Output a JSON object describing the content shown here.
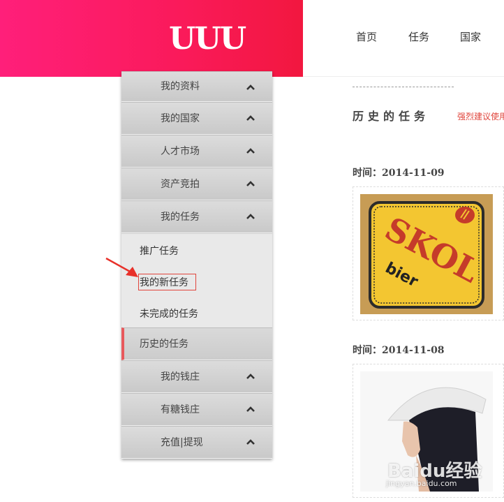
{
  "header": {
    "logo_text": "UUU",
    "nav": [
      {
        "label": "首页"
      },
      {
        "label": "任务"
      },
      {
        "label": "国家"
      }
    ]
  },
  "sidebar": {
    "items": [
      {
        "label": "我的资料"
      },
      {
        "label": "我的国家"
      },
      {
        "label": "人才市场"
      },
      {
        "label": "资产竞拍"
      },
      {
        "label": "我的任务"
      }
    ],
    "submenu": [
      {
        "label": "推广任务"
      },
      {
        "label": "我的新任务"
      },
      {
        "label": "未完成的任务"
      }
    ],
    "active_item": {
      "label": "历史的任务"
    },
    "bottom_items": [
      {
        "label": "我的钱庄"
      },
      {
        "label": "有糖钱庄"
      },
      {
        "label": "充值|提现"
      }
    ]
  },
  "content": {
    "title": "历史的任务",
    "note": "强烈建议使用",
    "entries": [
      {
        "time": "时间：2014-11-09",
        "image_text_1": "SKOL",
        "image_text_2": "bier"
      },
      {
        "time": "时间：2014-11-08"
      }
    ]
  },
  "watermark": {
    "text": "Baidu经验",
    "sub": "jingyan.baidu.com"
  },
  "colors": {
    "brand": "#fa1a5a",
    "accent": "#e8595c",
    "note": "#e0453c"
  }
}
